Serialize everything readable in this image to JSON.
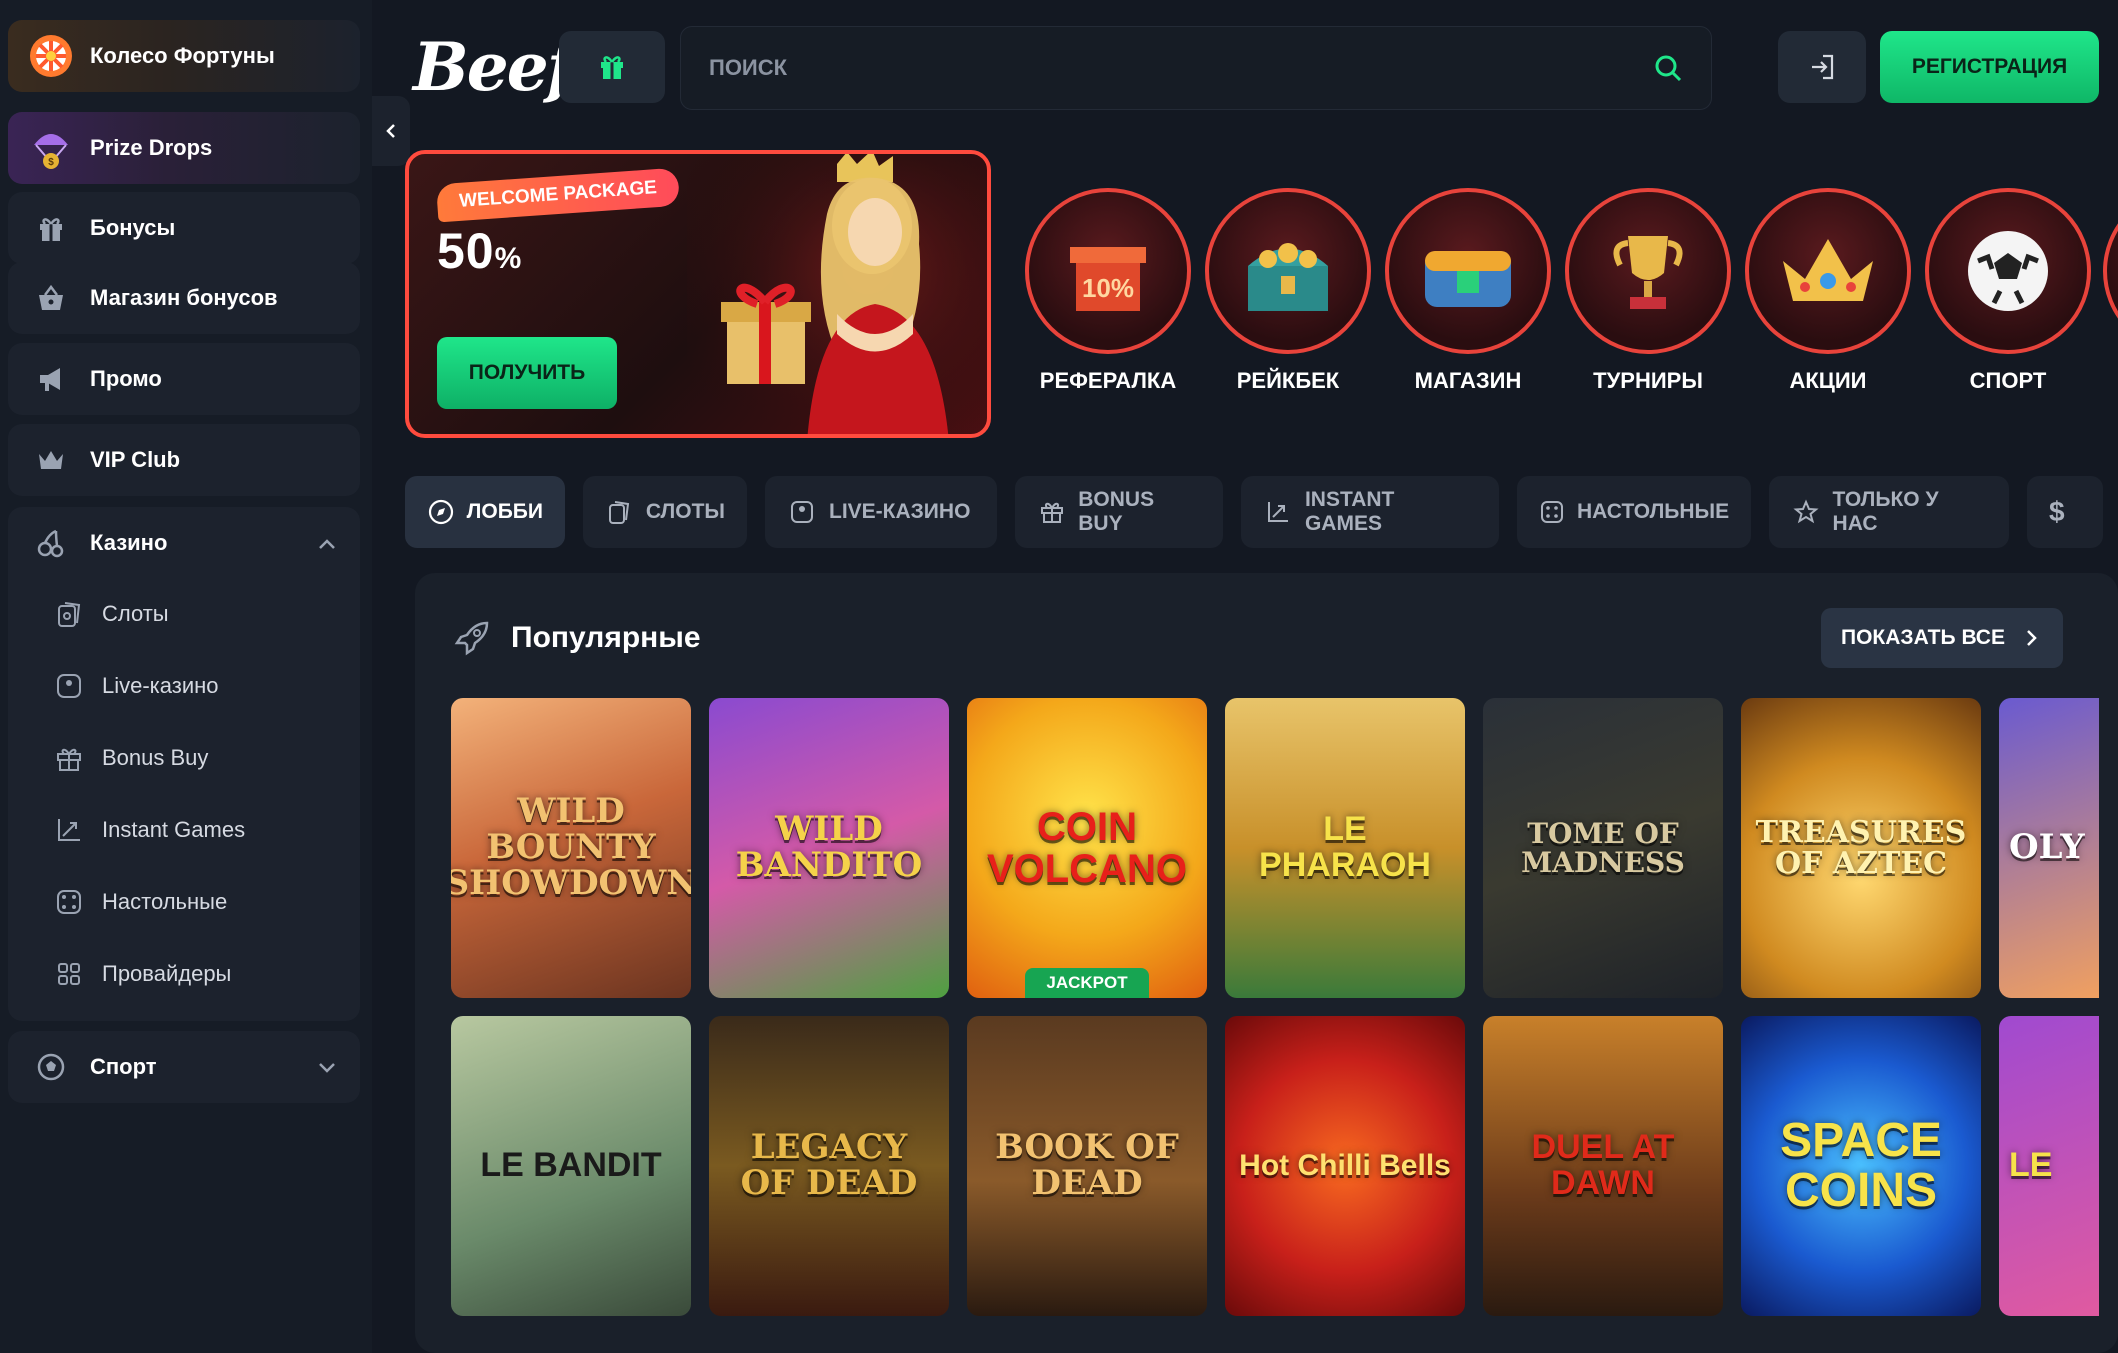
{
  "sidebar": {
    "fortune": "Колесо Фортуны",
    "prize_drops": "Prize Drops",
    "bonuses": "Бонусы",
    "bonus_shop": "Магазин бонусов",
    "promo": "Промо",
    "vip": "VIP Club",
    "casino": "Казино",
    "casino_items": [
      "Слоты",
      "Live-казино",
      "Bonus Buy",
      "Instant Games",
      "Настольные",
      "Провайдеры"
    ],
    "sport": "Спорт"
  },
  "header": {
    "logo": "Beef",
    "search_placeholder": "ПОИСК",
    "register": "РЕГИСТРАЦИЯ"
  },
  "banner": {
    "badge": "WELCOME PACKAGE",
    "percent": "50",
    "percent_sign": "%",
    "cta": "ПОЛУЧИТЬ"
  },
  "quick_links": [
    "РЕФЕРАЛКА",
    "РЕЙКБЕК",
    "МАГАЗИН",
    "ТУРНИРЫ",
    "АКЦИИ",
    "СПОРТ"
  ],
  "tabs": [
    "ЛОББИ",
    "СЛОТЫ",
    "LIVE-КАЗИНО",
    "BONUS BUY",
    "INSTANT GAMES",
    "НАСТОЛЬНЫЕ",
    "ТОЛЬКО У НАС",
    "$"
  ],
  "popular": {
    "title": "Популярные",
    "show_all": "ПОКАЗАТЬ ВСЕ",
    "games": [
      {
        "title": "WILD BOUNTY SHOWDOWN"
      },
      {
        "title": "WILD BANDITO"
      },
      {
        "title": "COIN VOLCANO",
        "badge": "JACKPOT"
      },
      {
        "title": "LE PHARAOH"
      },
      {
        "title": "TOME OF MADNESS"
      },
      {
        "title": "TREASURES OF AZTEC"
      },
      {
        "title": "OLY"
      },
      {
        "title": "LE BANDIT"
      },
      {
        "title": "LEGACY OF DEAD"
      },
      {
        "title": "BOOK OF DEAD"
      },
      {
        "title": "Hot Chilli Bells"
      },
      {
        "title": "DUEL AT DAWN"
      },
      {
        "title": "SPACE COINS"
      },
      {
        "title": "LE"
      }
    ]
  },
  "colors": {
    "accent_green": "#1fe68a",
    "banner_border": "#ff4b3e",
    "background": "#131822",
    "sidebar": "#161c26"
  }
}
